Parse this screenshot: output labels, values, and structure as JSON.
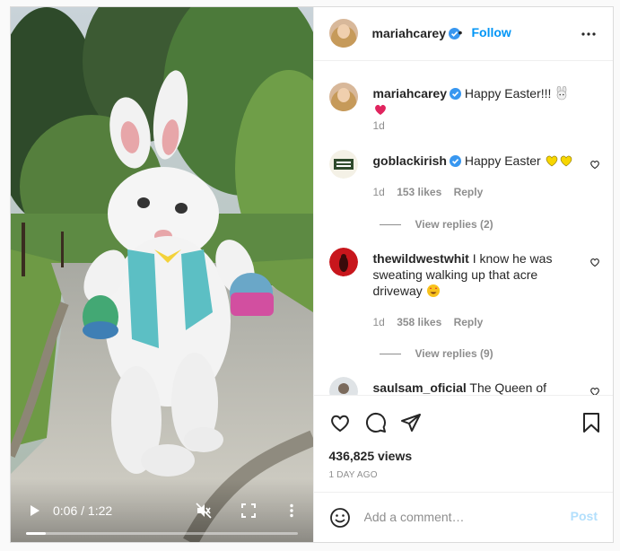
{
  "post": {
    "author": "mariahcarey",
    "follow_label": "Follow",
    "separator": "•",
    "caption": "Happy Easter!!!",
    "caption_age": "1d"
  },
  "video": {
    "time": "0:06 / 1:22",
    "progress": 0.073
  },
  "comments": [
    {
      "username": "goblackirish",
      "verified": true,
      "text": "Happy Easter",
      "age": "1d",
      "likes": "153 likes",
      "reply_label": "Reply",
      "view_replies": "View replies (2)"
    },
    {
      "username": "thewildwestwhit",
      "verified": false,
      "text": "I know he was sweating walking up that acre driveway",
      "age": "1d",
      "likes": "358 likes",
      "reply_label": "Reply",
      "view_replies": "View replies (9)"
    },
    {
      "username": "saulsam_oficial",
      "verified": false,
      "text": "The Queen of holidays is coming",
      "age": "",
      "likes": "",
      "reply_label": "",
      "view_replies": ""
    }
  ],
  "engagement": {
    "views": "436,825 views",
    "date": "1 DAY AGO"
  },
  "composer": {
    "placeholder": "Add a comment…",
    "post_label": "Post"
  },
  "colors": {
    "accent": "#0095f6",
    "verified": "#3897f0",
    "post_disabled": "#b2dffc",
    "muted_text": "#8e8e8e"
  },
  "icons": [
    "play-icon",
    "mute-icon",
    "fullscreen-icon",
    "more-icon",
    "verified-icon",
    "heart-icon",
    "comment-icon",
    "share-icon",
    "bookmark-icon",
    "emoji-icon"
  ]
}
